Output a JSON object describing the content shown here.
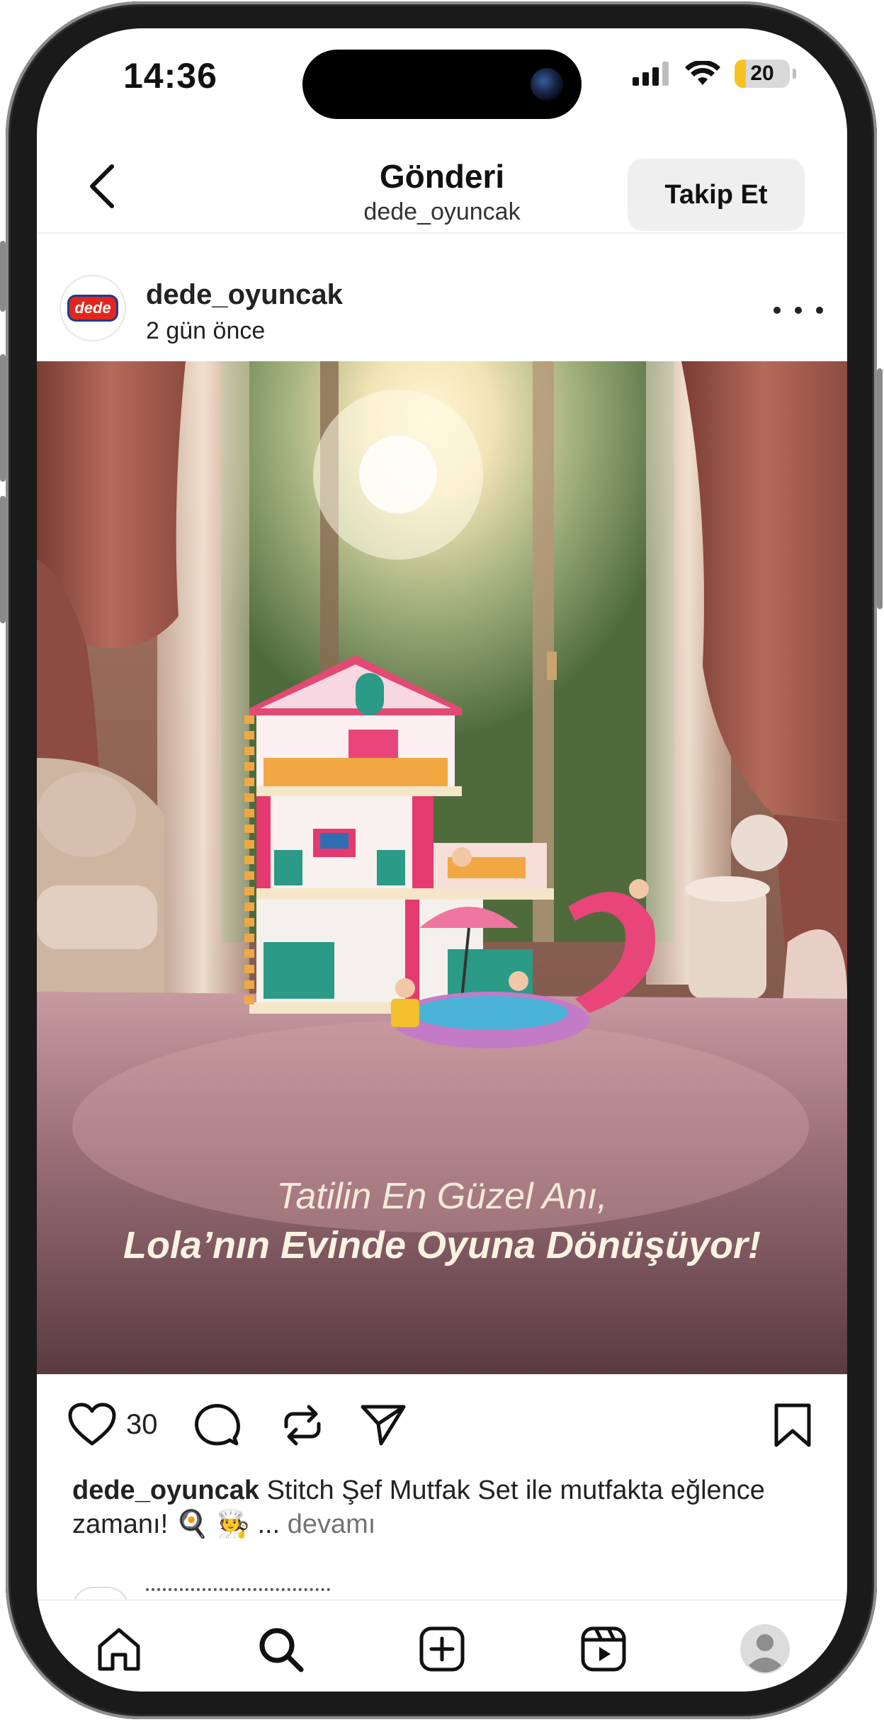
{
  "status_bar": {
    "time": "14:36",
    "battery_level": "20",
    "battery_fraction": 0.2,
    "icons": [
      "signal-icon",
      "wifi-icon",
      "battery-icon"
    ]
  },
  "header": {
    "title": "Gönderi",
    "subtitle": "dede_oyuncak",
    "follow_label": "Takip Et"
  },
  "post": {
    "username": "dede_oyuncak",
    "time_ago": "2 gün önce",
    "avatar_logo_text": "dede",
    "image_overlay": {
      "line1": "Tatilin En Güzel Anı,",
      "line2": "Lola’nın Evinde Oyuna Dönüşüyor!"
    },
    "like_count": "30",
    "caption_user": "dede_oyuncak",
    "caption_text": "Stitch Şef Mutfak Set ile mutfakta eğlence zamanı! 🍳 🧑‍🍳 ...",
    "more_label": "devamı"
  },
  "bottom_nav": [
    "home-icon",
    "search-icon",
    "create-icon",
    "reels-icon",
    "profile-icon"
  ],
  "colors": {
    "background": "#ffffff",
    "follow_button_bg": "#efefef",
    "battery_fill": "#f6c324",
    "text_primary": "#222222",
    "text_secondary": "#737373"
  }
}
